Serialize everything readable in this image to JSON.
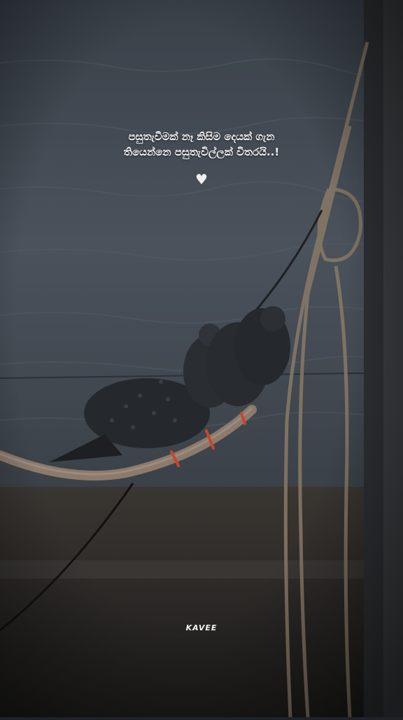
{
  "quote": {
    "line1": "පසුතැවීමක් නෑ කිසිම දෙයක් ගැන",
    "line2": "තියෙන්නෙ පසුතැවිල්ලක් විතරයි..!"
  },
  "heart": "♥",
  "watermark": "KAVEE",
  "colors": {
    "sea": "#3e4650",
    "wall": "#2b2a28",
    "pigeon": "#26292e",
    "feet": "#c8452e",
    "rope": "#8a7a66"
  },
  "photo": {
    "subject": "pigeons perched on a curved rail",
    "icons": [
      "heart-icon"
    ]
  }
}
